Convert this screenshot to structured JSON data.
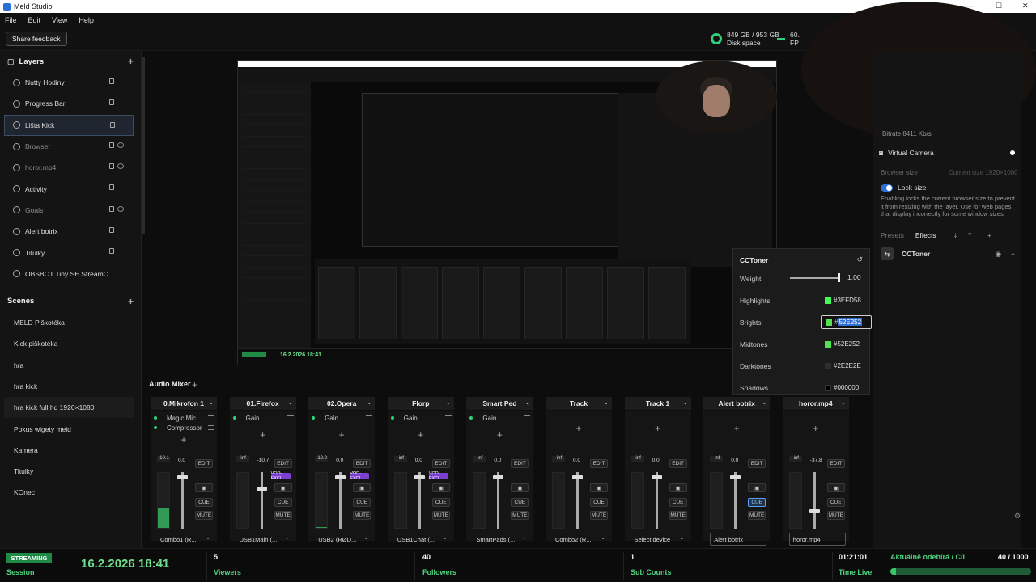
{
  "window": {
    "title": "Meld Studio"
  },
  "menu": [
    "File",
    "Edit",
    "View",
    "Help"
  ],
  "toolbar": {
    "feedback_label": "Share feedback",
    "disk_value": "849 GB / 953 GB",
    "disk_label": "Disk space",
    "fps_value": "60.",
    "fps_label": "FP"
  },
  "layers": {
    "title": "Layers",
    "items": [
      {
        "label": "Nutty Hodiny"
      },
      {
        "label": "Progress Bar"
      },
      {
        "label": "Lišta Kick"
      },
      {
        "label": "Browser"
      },
      {
        "label": "horor.mp4"
      },
      {
        "label": "Activity"
      },
      {
        "label": "Goals"
      },
      {
        "label": "Alert botrix"
      },
      {
        "label": "Titulky"
      },
      {
        "label": "OBSBOT Tiny SE StreamC..."
      }
    ]
  },
  "scenes": {
    "title": "Scenes",
    "items": [
      {
        "label": "MELD Piškotéka"
      },
      {
        "label": "Kick piškotéka"
      },
      {
        "label": "hra"
      },
      {
        "label": "hra kick"
      },
      {
        "label": "hra kick full hd 1920×1080"
      },
      {
        "label": "Pokus wigety meld"
      },
      {
        "label": "Kamera"
      },
      {
        "label": "Titulky"
      },
      {
        "label": "KOnec"
      }
    ]
  },
  "cctoner": {
    "title": "CCToner",
    "weight_label": "Weight",
    "weight_value": "1.00",
    "weight": 0.95,
    "rows": [
      {
        "label": "Highlights",
        "hex": "#3EFD58",
        "color": "#3EFD58"
      },
      {
        "label": "Brights",
        "hex_prefix": "#",
        "hex_selected": "52E252",
        "color": "#52E252"
      },
      {
        "label": "Midtones",
        "hex": "#52E252",
        "color": "#52E252"
      },
      {
        "label": "Darktones",
        "hex": "#2E2E2E",
        "color": "#2E2E2E"
      },
      {
        "label": "Shadows",
        "hex": "#000000",
        "color": "#000000"
      }
    ]
  },
  "right_panel": {
    "bitrate": "Bitrate  8411 Kb/s",
    "virtual_camera": "Virtual Camera",
    "browser_size": "Browser size",
    "current_size": "Current size  1920×1080",
    "lock_size": "Lock size",
    "lock_desc": "Enabling locks the current browser size to prevent it from resizing with the layer. Use for web pages that display incorrectly for some window sizes.",
    "tab_presets": "Presets",
    "tab_effects": "Effects",
    "effect_name": "CCToner"
  },
  "mixer": {
    "title": "Audio Mixer",
    "strips": [
      {
        "name": "0.Mikrofon 1",
        "fx": [
          "Magic Mic",
          "Compressor"
        ],
        "meter_top": "-10.1",
        "fader": "0.0",
        "vod": false,
        "cue_on": false,
        "device": "Combo1 (R...",
        "boxed": false,
        "level": 0.35,
        "fader_pos": 0.05
      },
      {
        "name": "01.Firefox",
        "fx": [
          "Gain"
        ],
        "meter_top": "-inf",
        "fader": "-10.7",
        "vod": true,
        "cue_on": false,
        "device": "USB1Main (...",
        "boxed": false,
        "level": 0.0,
        "fader_pos": 0.25
      },
      {
        "name": "02.Opera",
        "fx": [
          "Gain"
        ],
        "meter_top": "-12.0",
        "fader": "0.0",
        "vod": true,
        "cue_on": false,
        "device": "USB2 (RØD...",
        "boxed": false,
        "level": 0.02,
        "fader_pos": 0.05
      },
      {
        "name": "Florp",
        "fx": [
          "Gain"
        ],
        "meter_top": "-inf",
        "fader": "0.0",
        "vod": true,
        "cue_on": false,
        "device": "USB1Chat (...",
        "boxed": false,
        "level": 0.0,
        "fader_pos": 0.05
      },
      {
        "name": "Smart Ped",
        "fx": [
          "Gain"
        ],
        "meter_top": "-inf",
        "fader": "0.0",
        "vod": false,
        "cue_on": false,
        "device": "SmartPads (...",
        "boxed": false,
        "level": 0.0,
        "fader_pos": 0.05
      },
      {
        "name": "Track",
        "fx": [],
        "meter_top": "-inf",
        "fader": "0.0",
        "vod": false,
        "cue_on": false,
        "device": "Combo2 (R...",
        "boxed": false,
        "level": 0.0,
        "fader_pos": 0.05
      },
      {
        "name": "Track 1",
        "fx": [],
        "meter_top": "-inf",
        "fader": "0.0",
        "vod": false,
        "cue_on": false,
        "device": "Select device",
        "boxed": false,
        "level": 0.0,
        "fader_pos": 0.05
      },
      {
        "name": "Alert botrix",
        "fx": [],
        "meter_top": "-inf",
        "fader": "0.0",
        "vod": false,
        "cue_on": true,
        "device": "Alert botrix",
        "boxed": true,
        "level": 0.0,
        "fader_pos": 0.05
      },
      {
        "name": "horor.mp4",
        "fx": [],
        "meter_top": "-inf",
        "fader": "-37.8",
        "vod": false,
        "cue_on": false,
        "device": "horor.mp4",
        "boxed": true,
        "level": 0.0,
        "fader_pos": 0.65
      }
    ],
    "edit": "EDIT",
    "cue": "CUE",
    "mute": "MUTE",
    "vod_label": "VOD-EXCL"
  },
  "status": {
    "streaming": "STREAMING",
    "session": "Session",
    "date": "16.2.2026 18:41",
    "viewers_num": "5",
    "viewers": "Viewers",
    "followers_num": "40",
    "followers": "Followers",
    "subs_num": "1",
    "subs": "Sub Counts",
    "time": "01:21:01",
    "time_label": "Time Live",
    "goal_title": "Aktuálně odebírá / Cíl",
    "goal_value": "40 / 1000",
    "goal_fraction": 0.04
  },
  "preview": {
    "date": "16.2.2026 18:41"
  },
  "colors": {
    "accent_green": "#39c46a",
    "select_blue": "#2f6ed3"
  }
}
